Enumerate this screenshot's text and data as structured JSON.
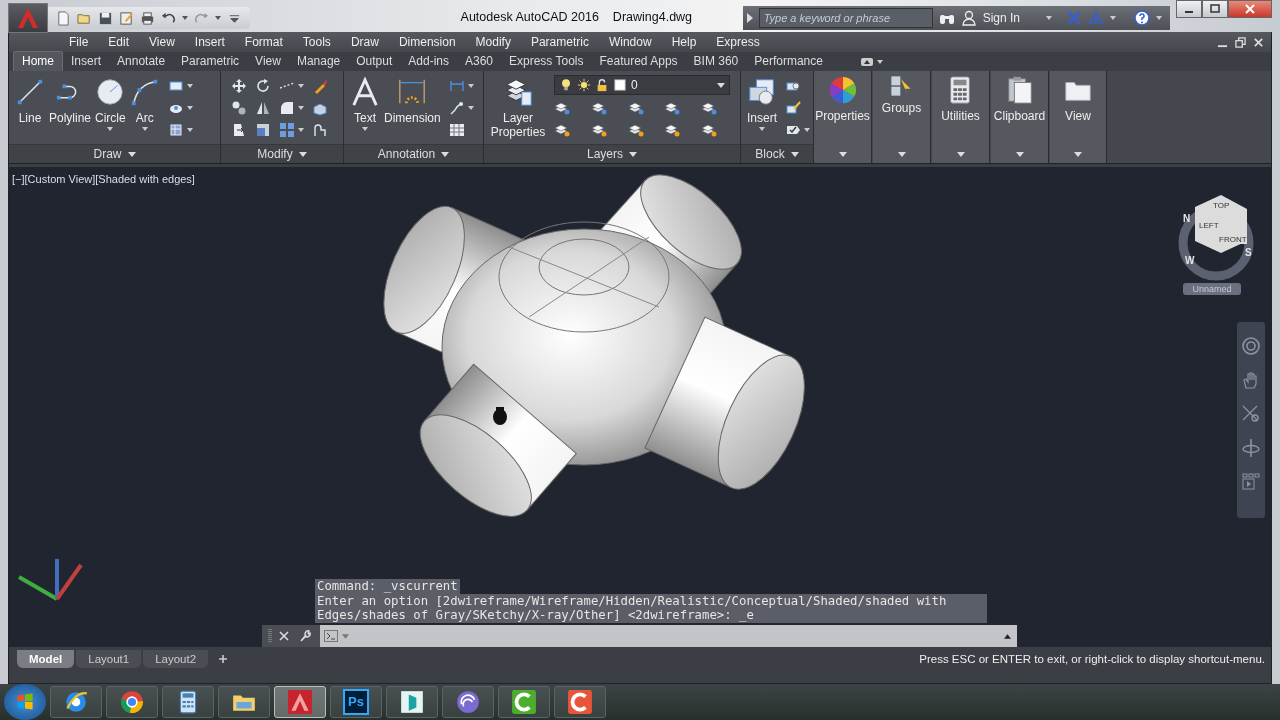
{
  "title_bar": {
    "app_title": "Autodesk AutoCAD 2016",
    "file_name": "Drawing4.dwg",
    "search": {
      "placeholder": "Type a keyword or phrase"
    },
    "sign_in": "Sign In"
  },
  "menu_bar": [
    "File",
    "Edit",
    "View",
    "Insert",
    "Format",
    "Tools",
    "Draw",
    "Dimension",
    "Modify",
    "Parametric",
    "Window",
    "Help",
    "Express"
  ],
  "ribbon_tabs": [
    {
      "label": "Home",
      "selected": true
    },
    {
      "label": "Insert",
      "selected": false
    },
    {
      "label": "Annotate",
      "selected": false
    },
    {
      "label": "Parametric",
      "selected": false
    },
    {
      "label": "View",
      "selected": false
    },
    {
      "label": "Manage",
      "selected": false
    },
    {
      "label": "Output",
      "selected": false
    },
    {
      "label": "Add-ins",
      "selected": false
    },
    {
      "label": "A360",
      "selected": false
    },
    {
      "label": "Express Tools",
      "selected": false
    },
    {
      "label": "Featured Apps",
      "selected": false
    },
    {
      "label": "BIM 360",
      "selected": false
    },
    {
      "label": "Performance",
      "selected": false
    }
  ],
  "ribbon_panels": [
    {
      "kind": "expanded",
      "title": "Draw",
      "tools": [
        "Line",
        "Polyline",
        "Circle",
        "Arc"
      ]
    },
    {
      "kind": "expanded",
      "title": "Modify"
    },
    {
      "kind": "expanded",
      "title": "Annotation",
      "tools": [
        "Text",
        "Dimension"
      ]
    },
    {
      "kind": "expanded",
      "title": "Layers",
      "tools": [
        "Layer Properties"
      ],
      "layer_dropdown": "0"
    },
    {
      "kind": "expanded",
      "title": "Block",
      "tools": [
        "Insert"
      ]
    },
    {
      "kind": "collapsed",
      "tools": [
        "Properties"
      ]
    },
    {
      "kind": "collapsed",
      "tools": [
        "Groups"
      ]
    },
    {
      "kind": "collapsed",
      "tools": [
        "Utilities"
      ]
    },
    {
      "kind": "collapsed",
      "tools": [
        "Clipboard"
      ]
    },
    {
      "kind": "collapsed",
      "tools": [
        "View"
      ]
    }
  ],
  "viewport": {
    "label": "[−][Custom View][Shaded with edges]",
    "view_cube": {
      "faces": [
        "TOP",
        "LEFT",
        "FRONT"
      ],
      "compass": [
        "N",
        "W",
        "S"
      ],
      "ucs_menu": "Unnamed"
    }
  },
  "command_line": {
    "history": [
      "Command: _vscurrent",
      "Enter an option [2dwireframe/Wireframe/Hidden/Realistic/Conceptual/Shaded/shaded with Edges/shades of Gray/SKetchy/X-ray/Other] <2dwireframe>: _e"
    ]
  },
  "layout_tabs": [
    {
      "label": "Model",
      "selected": true
    },
    {
      "label": "Layout1",
      "selected": false
    },
    {
      "label": "Layout2",
      "selected": false
    }
  ],
  "status_message": "Press ESC or ENTER to exit, or right-click to display shortcut-menu.",
  "taskbar": [
    {
      "kind": "start",
      "selected": false
    },
    {
      "kind": "ie",
      "selected": false
    },
    {
      "kind": "chrome",
      "selected": false
    },
    {
      "kind": "calculator",
      "selected": false
    },
    {
      "kind": "explorer",
      "selected": false
    },
    {
      "kind": "autocad",
      "selected": true
    },
    {
      "kind": "photoshop",
      "label": "Ps",
      "selected": false
    },
    {
      "kind": "max",
      "selected": false
    },
    {
      "kind": "torrent",
      "selected": false
    },
    {
      "kind": "camtasia",
      "selected": false
    },
    {
      "kind": "recorder",
      "selected": false
    }
  ]
}
